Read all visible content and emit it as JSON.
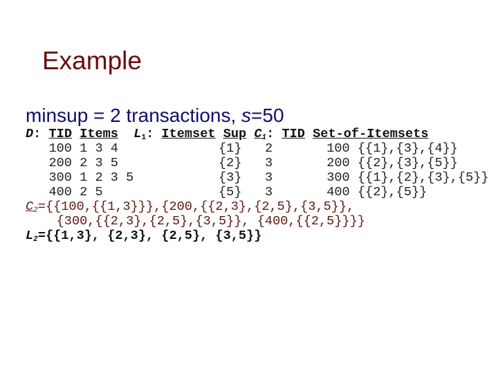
{
  "slide": {
    "title": "Example",
    "subtitle_prefix": "minsup = 2 transactions, ",
    "subtitle_var": "s",
    "subtitle_suffix": "=50"
  },
  "header": {
    "d_label": "D",
    "colon": ":",
    "tid": "TID",
    "items": "Items",
    "l1_label": "L",
    "l1_sub": "1",
    "itemset": "Itemset",
    "sup": "Sup",
    "c1_label": "C",
    "c1_sub": "1",
    "tid2": "TID",
    "set_of_itemsets": "Set-of-Itemsets"
  },
  "rows": [
    {
      "tid": "100",
      "items": "1 3 4",
      "itemset": "{1}",
      "sup": "2",
      "tid2": "100",
      "sets": "{{1},{3},{4}}"
    },
    {
      "tid": "200",
      "items": "2 3 5",
      "itemset": "{2}",
      "sup": "3",
      "tid2": "200",
      "sets": "{{2},{3},{5}}"
    },
    {
      "tid": "300",
      "items": "1 2 3 5",
      "itemset": "{3}",
      "sup": "3",
      "tid2": "300",
      "sets": "{{1},{2},{3},{5}}"
    },
    {
      "tid": "400",
      "items": "2 5",
      "itemset": "{5}",
      "sup": "3",
      "tid2": "400",
      "sets": "{{2},{5}}"
    }
  ],
  "c2": {
    "label": "C",
    "sub": "2",
    "line1": "={{100,{{1,3}}},{200,{{2,3},{2,5},{3,5}},",
    "line2": "{300,{{2,3},{2,5},{3,5}}, {400,{{2,5}}}}"
  },
  "l2": {
    "label": "L",
    "sub": "2",
    "value": "={{1,3}, {2,3}, {2,5}, {3,5}}"
  }
}
